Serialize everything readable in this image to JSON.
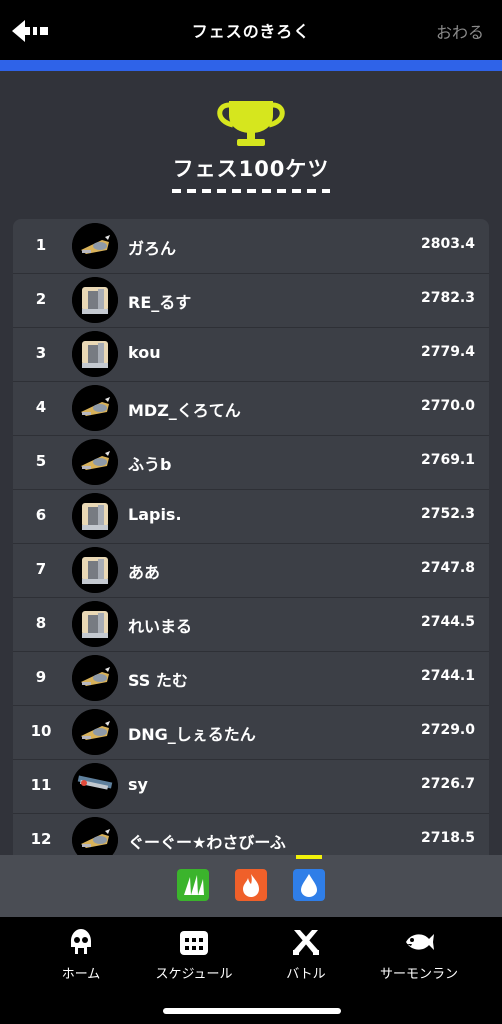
{
  "header": {
    "title": "フェスのきろく",
    "close_label": "おわる"
  },
  "section": {
    "heading": "フェス100ケツ"
  },
  "rows": [
    {
      "rank": "1",
      "name": "ガろん",
      "score": "2803.4",
      "weapon_icon": "splatling-icon"
    },
    {
      "rank": "2",
      "name": "RE_るす",
      "score": "2782.3",
      "weapon_icon": "brush-icon"
    },
    {
      "rank": "3",
      "name": "kou",
      "score": "2779.4",
      "weapon_icon": "brush-icon"
    },
    {
      "rank": "4",
      "name": "MDZ_くろてん",
      "score": "2770.0",
      "weapon_icon": "splatling-icon"
    },
    {
      "rank": "5",
      "name": "ふうb",
      "score": "2769.1",
      "weapon_icon": "splatling-icon"
    },
    {
      "rank": "6",
      "name": "Lapis.",
      "score": "2752.3",
      "weapon_icon": "brush-icon"
    },
    {
      "rank": "7",
      "name": "ああ",
      "score": "2747.8",
      "weapon_icon": "brush-icon"
    },
    {
      "rank": "8",
      "name": "れいまる",
      "score": "2744.5",
      "weapon_icon": "brush-icon"
    },
    {
      "rank": "9",
      "name": "SS たむ",
      "score": "2744.1",
      "weapon_icon": "splatling-icon"
    },
    {
      "rank": "10",
      "name": "DNG_しぇるたん",
      "score": "2729.0",
      "weapon_icon": "splatling-icon"
    },
    {
      "rank": "11",
      "name": "sy",
      "score": "2726.7",
      "weapon_icon": "charger-icon"
    },
    {
      "rank": "12",
      "name": "ぐーぐー★わさびーふ",
      "score": "2718.5",
      "weapon_icon": "splatling-icon"
    }
  ],
  "tabs": [
    {
      "icon": "grass-icon",
      "color": "#3bb42c"
    },
    {
      "icon": "fire-icon",
      "color": "#f0602a",
      "selected": false
    },
    {
      "icon": "water-drop-icon",
      "color": "#2f7ee8",
      "selected": true
    }
  ],
  "nav": [
    {
      "label": "ホーム",
      "icon": "squid-icon"
    },
    {
      "label": "スケジュール",
      "icon": "calendar-icon"
    },
    {
      "label": "バトル",
      "icon": "crossed-weapons-icon"
    },
    {
      "label": "サーモンラン",
      "icon": "salmon-icon"
    }
  ],
  "colors": {
    "accent_blue": "#2f63e8",
    "trophy_yellow": "#d6e61e",
    "tab_indicator": "#f2f20a"
  }
}
